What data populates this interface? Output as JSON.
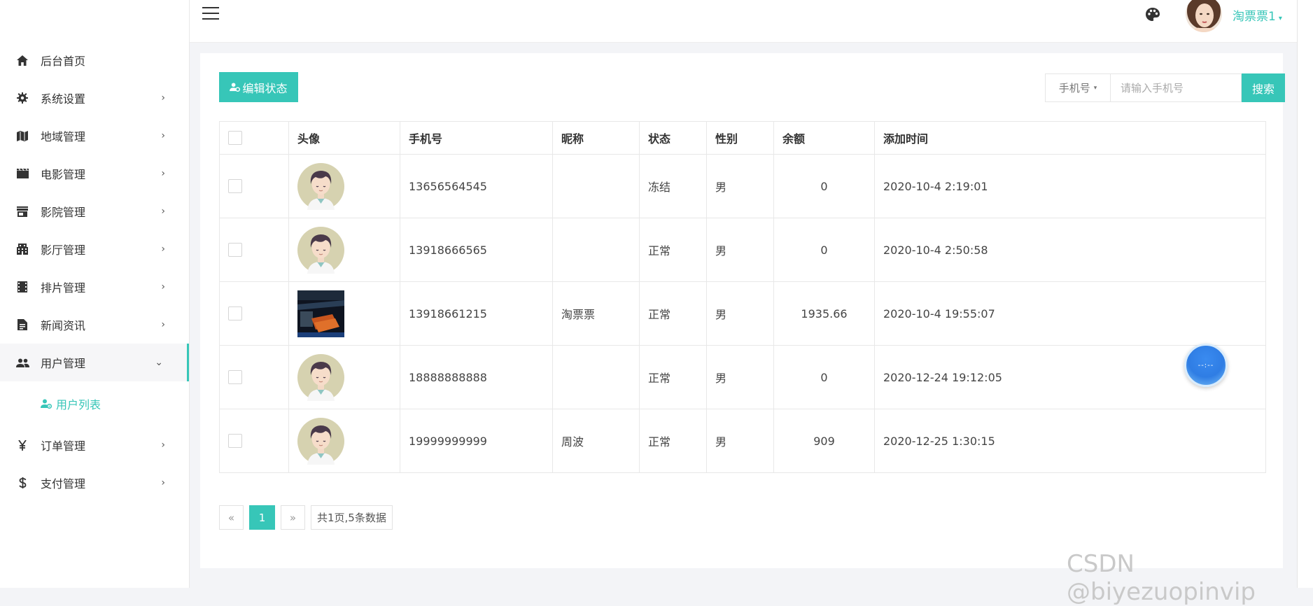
{
  "sidebar": {
    "items": [
      {
        "label": "后台首页",
        "icon": "home-icon",
        "has_arrow": false
      },
      {
        "label": "系统设置",
        "icon": "gear-icon",
        "has_arrow": true
      },
      {
        "label": "地域管理",
        "icon": "map-icon",
        "has_arrow": true
      },
      {
        "label": "电影管理",
        "icon": "movie-icon",
        "has_arrow": true
      },
      {
        "label": "影院管理",
        "icon": "store-icon",
        "has_arrow": true
      },
      {
        "label": "影厅管理",
        "icon": "building-icon",
        "has_arrow": true
      },
      {
        "label": "排片管理",
        "icon": "film-strip-icon",
        "has_arrow": true
      },
      {
        "label": "新闻资讯",
        "icon": "article-icon",
        "has_arrow": true
      },
      {
        "label": "用户管理",
        "icon": "users-icon",
        "has_arrow": true,
        "expanded": true
      },
      {
        "label": "订单管理",
        "icon": "yen-icon",
        "has_arrow": true
      },
      {
        "label": "支付管理",
        "icon": "dollar-icon",
        "has_arrow": true
      }
    ],
    "subitem": {
      "label": "用户列表",
      "icon": "user-settings-icon"
    },
    "arrow_right": "›",
    "arrow_down": "⌄"
  },
  "header": {
    "username": "淘票票1",
    "caret": "▾"
  },
  "toolbar": {
    "edit_label": "编辑状态",
    "search_field": "手机号",
    "search_caret": "▾",
    "search_placeholder": "请输入手机号",
    "search_label": "搜索"
  },
  "table": {
    "columns": [
      "头像",
      "手机号",
      "昵称",
      "状态",
      "性别",
      "余额",
      "添加时间"
    ],
    "rows": [
      {
        "avatar": "cartoon",
        "phone": "13656564545",
        "nickname": "",
        "status": "冻结",
        "status_type": "frozen",
        "gender": "男",
        "balance": "0",
        "added": "2020-10-4 2:19:01"
      },
      {
        "avatar": "cartoon",
        "phone": "13918666565",
        "nickname": "",
        "status": "正常",
        "status_type": "normal",
        "gender": "男",
        "balance": "0",
        "added": "2020-10-4 2:50:58"
      },
      {
        "avatar": "photo",
        "phone": "13918661215",
        "nickname": "淘票票",
        "status": "正常",
        "status_type": "normal",
        "gender": "男",
        "balance": "1935.66",
        "added": "2020-10-4 19:55:07"
      },
      {
        "avatar": "cartoon",
        "phone": "18888888888",
        "nickname": "",
        "status": "正常",
        "status_type": "normal",
        "gender": "男",
        "balance": "0",
        "added": "2020-12-24 19:12:05"
      },
      {
        "avatar": "cartoon",
        "phone": "19999999999",
        "nickname": "周波",
        "status": "正常",
        "status_type": "normal",
        "gender": "男",
        "balance": "909",
        "added": "2020-12-25 1:30:15"
      }
    ]
  },
  "pagination": {
    "prev": "«",
    "current": "1",
    "next": "»",
    "summary": "共1页,5条数据"
  },
  "float_ball": {
    "label": "--:--"
  },
  "watermark": "CSDN @biyezuopinvip",
  "colors": {
    "accent": "#37c6b8",
    "status_normal": "#1ab394",
    "status_frozen": "#f0a04b"
  }
}
